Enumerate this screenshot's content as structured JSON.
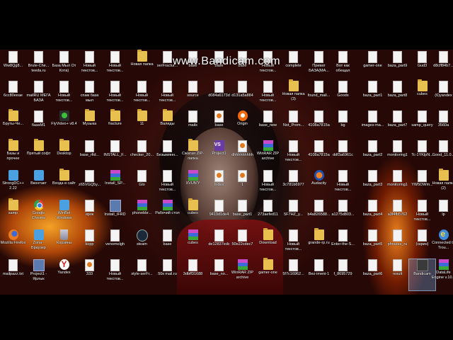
{
  "watermark": "www.Bandicam.com",
  "columns": [
    [
      {
        "label": "Ww8Qg8...",
        "icon": "document"
      },
      {
        "label": "6cc80eeae",
        "icon": "document"
      },
      {
        "label": "Бруты-Че...",
        "icon": "folder"
      },
      {
        "label": "Базы и прочее",
        "icon": "folder"
      },
      {
        "label": "StrongDC++ 2.22",
        "icon": "shortcut"
      },
      {
        "label": "samp",
        "icon": "folder"
      },
      {
        "label": "Mozilla Firefox",
        "icon": "firefox"
      },
      {
        "label": "mailpazz.txt",
        "icon": "document"
      }
    ],
    [
      {
        "label": "Brute-Che... teeda.ru",
        "icon": "document"
      },
      {
        "label": "mailRU МЕГА БАЗА",
        "icon": "document"
      },
      {
        "label": "базаМ1",
        "icon": "document"
      },
      {
        "label": "Прятый софт",
        "icon": "folder"
      },
      {
        "label": "Вконтакт",
        "icon": "shortcut"
      },
      {
        "label": "Google Chrome",
        "icon": "chrome"
      },
      {
        "label": "Zona - Браузер",
        "icon": "shortcut"
      },
      {
        "label": "Project1 - Ярлык",
        "icon": "exe"
      }
    ],
    [
      {
        "label": "База Мыл От Кота)",
        "icon": "document"
      },
      {
        "label": "Новый текстов...",
        "icon": "document"
      },
      {
        "label": "FlyVideo+ v8.4",
        "icon": "flyvideo"
      },
      {
        "label": "Desktop",
        "icon": "folder"
      },
      {
        "label": "Входа в сайт",
        "icon": "folder"
      },
      {
        "label": "WinBet Windows",
        "icon": "shortcut"
      },
      {
        "label": "Корзина",
        "icon": "recycle"
      },
      {
        "label": "Yandex",
        "icon": "yandex"
      }
    ],
    [
      {
        "label": "Новый текстов...",
        "icon": "document"
      },
      {
        "label": "спам база мыл",
        "icon": "document"
      },
      {
        "label": "Музыка",
        "icon": "folder"
      },
      {
        "label": "base_rfid...",
        "icon": "document"
      },
      {
        "label": "z65VGQ5y...",
        "icon": "document"
      },
      {
        "label": "ирок",
        "icon": "document"
      },
      {
        "label": "kopp",
        "icon": "document"
      },
      {
        "label": "333",
        "icon": "html"
      }
    ],
    [
      {
        "label": "Новый текстов...",
        "icon": "document"
      },
      {
        "label": "Новый текстов...",
        "icon": "document"
      },
      {
        "label": "fracture",
        "icon": "folder"
      },
      {
        "label": "INSTALL_F...",
        "icon": "document"
      },
      {
        "label": "Install_SP...",
        "icon": "rar"
      },
      {
        "label": "Install_IFRD",
        "icon": "exe"
      },
      {
        "label": "venomolgh",
        "icon": "document"
      },
      {
        "label": "Новый текстов...",
        "icon": "document"
      }
    ],
    [
      {
        "label": "Новая папка",
        "icon": "folder"
      },
      {
        "label": "Новый текстов...",
        "icon": "document"
      },
      {
        "label": "11",
        "icon": "folder"
      },
      {
        "label": "checker_20...",
        "icon": "document"
      },
      {
        "label": "Glo",
        "icon": "document"
      },
      {
        "label": "phonebbr...",
        "icon": "rar"
      },
      {
        "label": "steam",
        "icon": "steam"
      },
      {
        "label": "style-serFr...",
        "icon": "document"
      }
    ],
    [
      {
        "label": "serFractur...",
        "icon": "document"
      },
      {
        "label": "Новый текстов...",
        "icon": "document"
      },
      {
        "label": "Валиды",
        "icon": "folder"
      },
      {
        "label": "Безымянн...",
        "icon": "document"
      },
      {
        "label": "Новый текстов...",
        "icon": "document"
      },
      {
        "label": "Рабочий стол",
        "icon": "rar"
      },
      {
        "label": "base",
        "icon": "document"
      },
      {
        "label": "50к mail.ru",
        "icon": "document"
      }
    ],
    [
      {
        "label": "base",
        "icon": "document"
      },
      {
        "label": "source",
        "icon": "document"
      },
      {
        "label": "mails",
        "icon": "document"
      },
      {
        "label": "Сжатая ZIP-папка",
        "icon": "folder"
      },
      {
        "label": "XVUN'Y",
        "icon": "rar"
      },
      {
        "label": "cubes",
        "icon": "folder"
      },
      {
        "label": "cubes",
        "icon": "rar"
      },
      {
        "label": "3dbff31688",
        "icon": "document"
      }
    ],
    [
      {
        "label": "base",
        "icon": "document"
      },
      {
        "label": "d084a6173d",
        "icon": "document"
      },
      {
        "label": "base",
        "icon": "html"
      },
      {
        "label": "Project1",
        "icon": "vs"
      },
      {
        "label": "Index",
        "icon": "html"
      },
      {
        "label": "9419d1de4",
        "icon": "document"
      },
      {
        "label": "de12837edc",
        "icon": "document"
      },
      {
        "label": "base_no...",
        "icon": "document"
      }
    ],
    [
      {
        "label": "base",
        "icon": "document"
      },
      {
        "label": "d131a5a884",
        "icon": "document"
      },
      {
        "label": "Origin",
        "icon": "origin"
      },
      {
        "label": "dhhhhhhhhh",
        "icon": "html"
      },
      {
        "label": "1",
        "icon": "html"
      },
      {
        "label": "base_part1",
        "icon": "document"
      },
      {
        "label": "50e22cdec7",
        "icon": "document"
      },
      {
        "label": "WinRAR ZIP archive",
        "icon": "rar"
      }
    ],
    [
      {
        "label": "Новый текстов...",
        "icon": "document"
      },
      {
        "label": "Новый текстов...",
        "icon": "document"
      },
      {
        "label": "base_new",
        "icon": "document"
      },
      {
        "label": "WinRAR ZIP archive",
        "icon": "rar"
      },
      {
        "label": "Новый текстов...",
        "icon": "document"
      },
      {
        "label": "273aefed11",
        "icon": "document"
      },
      {
        "label": "Download",
        "icon": "folder"
      },
      {
        "label": "gamer-one",
        "icon": "folder"
      }
    ],
    [
      {
        "label": "complete",
        "icon": "document"
      },
      {
        "label": "Новая папка (3)",
        "icon": "folder"
      },
      {
        "label": "Not_Prem...",
        "icon": "document"
      },
      {
        "label": "Новый текстов...",
        "icon": "document"
      },
      {
        "label": "3c781b6977",
        "icon": "document"
      },
      {
        "label": "5F7HZ_y...",
        "icon": "document"
      },
      {
        "label": "Новый текстов...",
        "icon": "document"
      },
      {
        "label": "5f7c16962...",
        "icon": "document"
      }
    ],
    [
      {
        "label": "Приват БАЗА(МА...",
        "icon": "document"
      },
      {
        "label": "found_mail...",
        "icon": "document"
      },
      {
        "label": "4108a7815a",
        "icon": "document"
      },
      {
        "label": "4108a7815a",
        "icon": "document"
      },
      {
        "label": "Audacity",
        "icon": "audacity"
      },
      {
        "label": "b4a826588...",
        "icon": "document"
      },
      {
        "label": "grande-rp.ru",
        "icon": "folder"
      },
      {
        "label": "Bez-imeni-1",
        "icon": "document"
      }
    ],
    [
      {
        "label": "Вот как обещал",
        "icon": "document"
      },
      {
        "label": "Goods",
        "icon": "document"
      },
      {
        "label": "bg",
        "icon": "document"
      },
      {
        "label": "ddf3a6961c",
        "icon": "document"
      },
      {
        "label": "Новый текстов...",
        "icon": "document"
      },
      {
        "label": "a1275d803...",
        "icon": "document"
      },
      {
        "label": "Enter-the-S...",
        "icon": "document"
      },
      {
        "label": "f_8695729",
        "icon": "document"
      }
    ],
    [
      {
        "label": "gamer-one",
        "icon": "document"
      },
      {
        "label": "baza_part1",
        "icon": "document"
      },
      {
        "label": "images-ma...",
        "icon": "document"
      },
      {
        "label": "baza_part2",
        "icon": "document"
      },
      {
        "label": "baza_part3",
        "icon": "document"
      },
      {
        "label": "baza_part4",
        "icon": "document"
      },
      {
        "label": "baza_part5",
        "icon": "document"
      },
      {
        "label": "baza_part6",
        "icon": "document"
      }
    ],
    [
      {
        "label": "baza_part9",
        "icon": "document"
      },
      {
        "label": "baza_part8",
        "icon": "document"
      },
      {
        "label": "baza_part7",
        "icon": "document"
      },
      {
        "label": "monitoring1",
        "icon": "document"
      },
      {
        "label": "monitoring1",
        "icon": "document"
      },
      {
        "label": "a3f4fb5762",
        "icon": "document"
      },
      {
        "label": "phrases_ru",
        "icon": "document"
      },
      {
        "label": "result",
        "icon": "document"
      }
    ],
    [
      {
        "label": "Gud3",
        "icon": "document"
      },
      {
        "label": "cubes",
        "icon": "folder"
      },
      {
        "label": "samp_query",
        "icon": "document"
      },
      {
        "label": "Tc-1YKlpN...",
        "icon": "document"
      },
      {
        "label": "YW5OWm...",
        "icon": "document"
      },
      {
        "label": "Новый текстов...",
        "icon": "document"
      },
      {
        "label": "(скрин)",
        "icon": "document"
      },
      {
        "label": "Bandicam",
        "icon": "bandi"
      }
    ],
    [
      {
        "label": "d8cff84b7...",
        "icon": "document"
      },
      {
        "label": "(6)yandex",
        "icon": "document"
      },
      {
        "label": "3560a",
        "icon": "document"
      },
      {
        "label": "Good_11.0...",
        "icon": "document"
      },
      {
        "label": "Новая папка (2)",
        "icon": "folder"
      },
      {
        "label": "lp",
        "icon": "document"
      },
      {
        "label": "Connected to Trou...",
        "icon": "ie"
      },
      {
        "label": "DataLife Engine v.10...",
        "icon": "rar"
      }
    ]
  ]
}
